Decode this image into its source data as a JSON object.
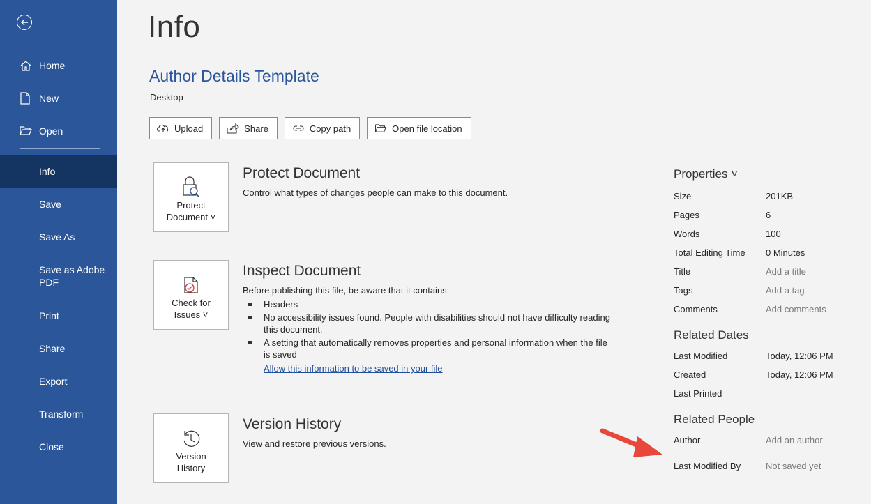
{
  "sidebar": {
    "top_items": [
      {
        "label": "Home",
        "icon": "home-icon"
      },
      {
        "label": "New",
        "icon": "new-document-icon"
      },
      {
        "label": "Open",
        "icon": "open-folder-icon"
      }
    ],
    "items": [
      {
        "label": "Info"
      },
      {
        "label": "Save"
      },
      {
        "label": "Save As"
      },
      {
        "label": "Save as Adobe PDF"
      },
      {
        "label": "Print"
      },
      {
        "label": "Share"
      },
      {
        "label": "Export"
      },
      {
        "label": "Transform"
      },
      {
        "label": "Close"
      }
    ],
    "active": "Info",
    "color": "#2b579a",
    "active_color": "#143562"
  },
  "page": {
    "title": "Info",
    "doc_name": "Author Details Template",
    "location": "Desktop"
  },
  "toolbar": {
    "upload": "Upload",
    "share": "Share",
    "copy_path": "Copy path",
    "open_location": "Open file location"
  },
  "protect": {
    "button_line1": "Protect",
    "button_line2": "Document ˅",
    "title": "Protect Document",
    "desc": "Control what types of changes people can make to this document."
  },
  "inspect": {
    "button_line1": "Check for",
    "button_line2": "Issues ˅",
    "title": "Inspect Document",
    "desc": "Before publishing this file, be aware that it contains:",
    "bullets": [
      "Headers",
      "No accessibility issues found. People with disabilities should not have difficulty reading this document.",
      "A setting that automatically removes properties and personal information when the file is saved"
    ],
    "link": "Allow this information to be saved in your file"
  },
  "version": {
    "button_line1": "Version",
    "button_line2": "History",
    "title": "Version History",
    "desc": "View and restore previous versions."
  },
  "properties": {
    "heading": "Properties ˅",
    "rows": [
      {
        "key": "Size",
        "value": "201KB"
      },
      {
        "key": "Pages",
        "value": "6"
      },
      {
        "key": "Words",
        "value": "100"
      },
      {
        "key": "Total Editing Time",
        "value": "0 Minutes"
      },
      {
        "key": "Title",
        "value": "Add a title"
      },
      {
        "key": "Tags",
        "value": "Add a tag"
      },
      {
        "key": "Comments",
        "value": "Add comments"
      }
    ],
    "dates_heading": "Related Dates",
    "dates": [
      {
        "key": "Last Modified",
        "value": "Today, 12:06 PM"
      },
      {
        "key": "Created",
        "value": "Today, 12:06 PM"
      },
      {
        "key": "Last Printed",
        "value": ""
      }
    ],
    "people_heading": "Related People",
    "people": [
      {
        "key": "Author",
        "value": "Add an author"
      },
      {
        "key": "Last Modified By",
        "value": "Not saved yet"
      }
    ]
  },
  "annotation": {
    "arrow_color": "#e8473c"
  }
}
